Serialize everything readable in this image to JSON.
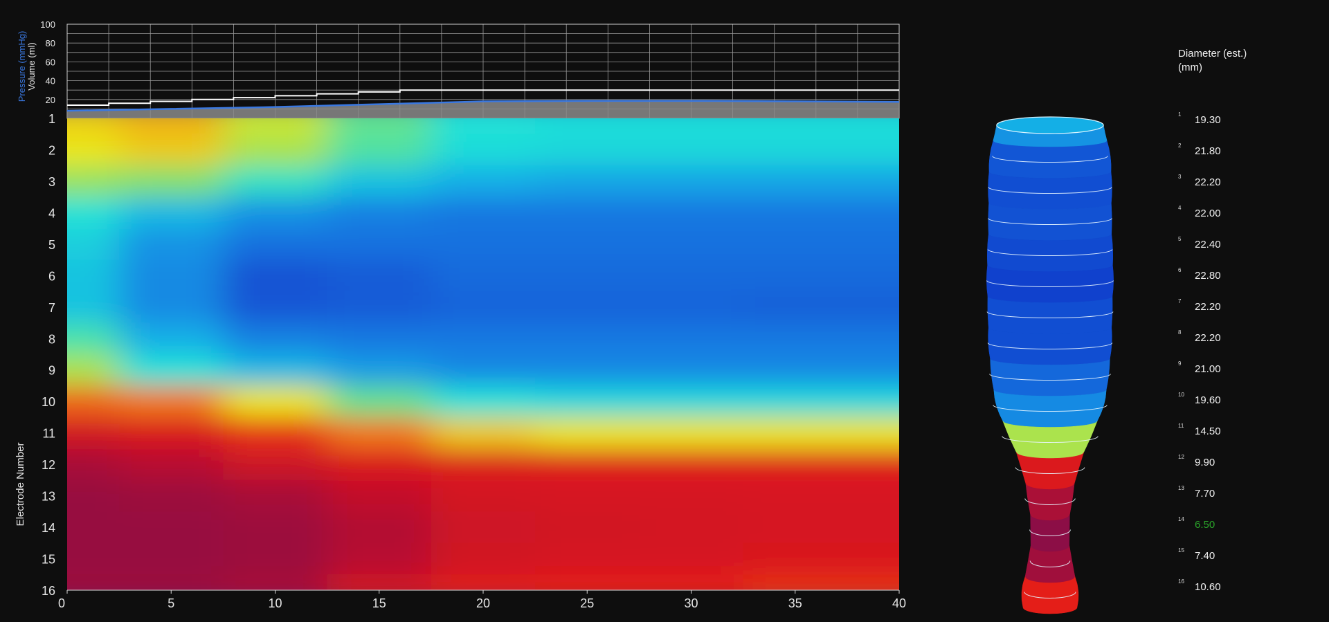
{
  "top_chart": {
    "y_ticks": [
      "100",
      "80",
      "60",
      "40",
      "20"
    ],
    "pressure_label": "Pressure (mmHg)",
    "volume_label": "Volume (ml)",
    "colors": {
      "pressure": "#3a78e0",
      "volume": "#ffffff",
      "fill": "#8a8a8a"
    }
  },
  "heatmap": {
    "ylabel": "Electrode Number",
    "x_ticks": [
      "0",
      "5",
      "10",
      "15",
      "20",
      "25",
      "30",
      "35",
      "40"
    ],
    "y_ticks": [
      "1",
      "2",
      "3",
      "4",
      "5",
      "6",
      "7",
      "8",
      "9",
      "10",
      "11",
      "12",
      "13",
      "14",
      "15",
      "16"
    ]
  },
  "chart_data": [
    {
      "type": "line",
      "xlim": [
        0,
        40
      ],
      "ylim": [
        0,
        100
      ],
      "y_ticks": [
        20,
        40,
        60,
        80,
        100
      ],
      "grid": true,
      "series": [
        {
          "name": "Volume (ml)",
          "x": [
            0,
            2,
            4,
            6,
            8,
            10,
            12,
            14,
            16,
            20,
            25,
            30,
            35,
            40
          ],
          "y": [
            14,
            16,
            18,
            20,
            22,
            24,
            26,
            28,
            30,
            30,
            30,
            30,
            30,
            30
          ]
        },
        {
          "name": "Pressure (mmHg)",
          "x": [
            0,
            5,
            10,
            15,
            20,
            25,
            30,
            35,
            40
          ],
          "y": [
            8,
            10,
            12,
            15,
            18,
            18.5,
            18.5,
            18,
            17.5
          ]
        }
      ]
    },
    {
      "type": "heatmap",
      "xlabel": "",
      "ylabel": "Electrode Number",
      "xlim": [
        0,
        40
      ],
      "ylim": [
        1,
        16
      ],
      "x_ticks": [
        0,
        5,
        10,
        15,
        20,
        25,
        30,
        35,
        40
      ],
      "y_ticks": [
        1,
        2,
        3,
        4,
        5,
        6,
        7,
        8,
        9,
        10,
        11,
        12,
        13,
        14,
        15,
        16
      ],
      "value_scale": "0 = purple-red (narrow) ... 1 = blue (wide)",
      "x_samples": [
        0,
        5,
        10,
        15,
        20,
        25,
        30,
        35,
        40
      ],
      "rows": [
        {
          "electrode": 1,
          "values": [
            0.4,
            0.38,
            0.45,
            0.55,
            0.62,
            0.63,
            0.63,
            0.63,
            0.63
          ]
        },
        {
          "electrode": 2,
          "values": [
            0.42,
            0.4,
            0.48,
            0.57,
            0.63,
            0.64,
            0.64,
            0.64,
            0.64
          ]
        },
        {
          "electrode": 3,
          "values": [
            0.5,
            0.52,
            0.6,
            0.68,
            0.72,
            0.74,
            0.74,
            0.74,
            0.74
          ]
        },
        {
          "electrode": 4,
          "values": [
            0.62,
            0.7,
            0.78,
            0.82,
            0.84,
            0.84,
            0.84,
            0.84,
            0.84
          ]
        },
        {
          "electrode": 5,
          "values": [
            0.66,
            0.78,
            0.86,
            0.86,
            0.86,
            0.86,
            0.86,
            0.86,
            0.86
          ]
        },
        {
          "electrode": 6,
          "values": [
            0.68,
            0.8,
            0.95,
            0.92,
            0.88,
            0.88,
            0.88,
            0.88,
            0.88
          ]
        },
        {
          "electrode": 7,
          "values": [
            0.68,
            0.8,
            0.94,
            0.92,
            0.9,
            0.9,
            0.9,
            0.91,
            0.91
          ]
        },
        {
          "electrode": 8,
          "values": [
            0.58,
            0.72,
            0.82,
            0.84,
            0.84,
            0.84,
            0.84,
            0.84,
            0.84
          ]
        },
        {
          "electrode": 9,
          "values": [
            0.48,
            0.62,
            0.7,
            0.76,
            0.8,
            0.8,
            0.8,
            0.8,
            0.8
          ]
        },
        {
          "electrode": 10,
          "values": [
            0.32,
            0.34,
            0.42,
            0.55,
            0.62,
            0.64,
            0.64,
            0.64,
            0.64
          ]
        },
        {
          "electrode": 11,
          "values": [
            0.14,
            0.18,
            0.26,
            0.34,
            0.4,
            0.42,
            0.42,
            0.42,
            0.42
          ]
        },
        {
          "electrode": 12,
          "values": [
            0.05,
            0.08,
            0.12,
            0.18,
            0.2,
            0.21,
            0.21,
            0.21,
            0.21
          ]
        },
        {
          "electrode": 13,
          "values": [
            0.02,
            0.03,
            0.05,
            0.1,
            0.15,
            0.16,
            0.16,
            0.17,
            0.17
          ]
        },
        {
          "electrode": 14,
          "values": [
            0.02,
            0.02,
            0.03,
            0.07,
            0.12,
            0.14,
            0.15,
            0.16,
            0.16
          ]
        },
        {
          "electrode": 15,
          "values": [
            0.02,
            0.02,
            0.03,
            0.08,
            0.14,
            0.16,
            0.16,
            0.18,
            0.18
          ]
        },
        {
          "electrode": 16,
          "values": [
            0.03,
            0.03,
            0.05,
            0.14,
            0.22,
            0.24,
            0.24,
            0.26,
            0.26
          ]
        }
      ]
    },
    {
      "type": "bar",
      "title": "Diameter (est.) (mm)",
      "categories": [
        "1",
        "2",
        "3",
        "4",
        "5",
        "6",
        "7",
        "8",
        "9",
        "10",
        "11",
        "12",
        "13",
        "14",
        "15",
        "16"
      ],
      "values": [
        19.3,
        21.8,
        22.2,
        22.0,
        22.4,
        22.8,
        22.2,
        22.2,
        21.0,
        19.6,
        14.5,
        9.9,
        7.7,
        6.5,
        7.4,
        10.6
      ],
      "highlight_index": 13,
      "colors": {
        "highlight": "#2aa52a"
      }
    }
  ],
  "diameter_panel": {
    "title": "Diameter (est.) (mm)",
    "rows": [
      {
        "idx": "1",
        "value": "19.30"
      },
      {
        "idx": "2",
        "value": "21.80"
      },
      {
        "idx": "3",
        "value": "22.20"
      },
      {
        "idx": "4",
        "value": "22.00"
      },
      {
        "idx": "5",
        "value": "22.40"
      },
      {
        "idx": "6",
        "value": "22.80"
      },
      {
        "idx": "7",
        "value": "22.20"
      },
      {
        "idx": "8",
        "value": "22.20"
      },
      {
        "idx": "9",
        "value": "21.00"
      },
      {
        "idx": "10",
        "value": "19.60"
      },
      {
        "idx": "11",
        "value": "14.50"
      },
      {
        "idx": "12",
        "value": "9.90"
      },
      {
        "idx": "13",
        "value": "7.70"
      },
      {
        "idx": "14",
        "value": "6.50"
      },
      {
        "idx": "15",
        "value": "7.40"
      },
      {
        "idx": "16",
        "value": "10.60"
      }
    ]
  }
}
